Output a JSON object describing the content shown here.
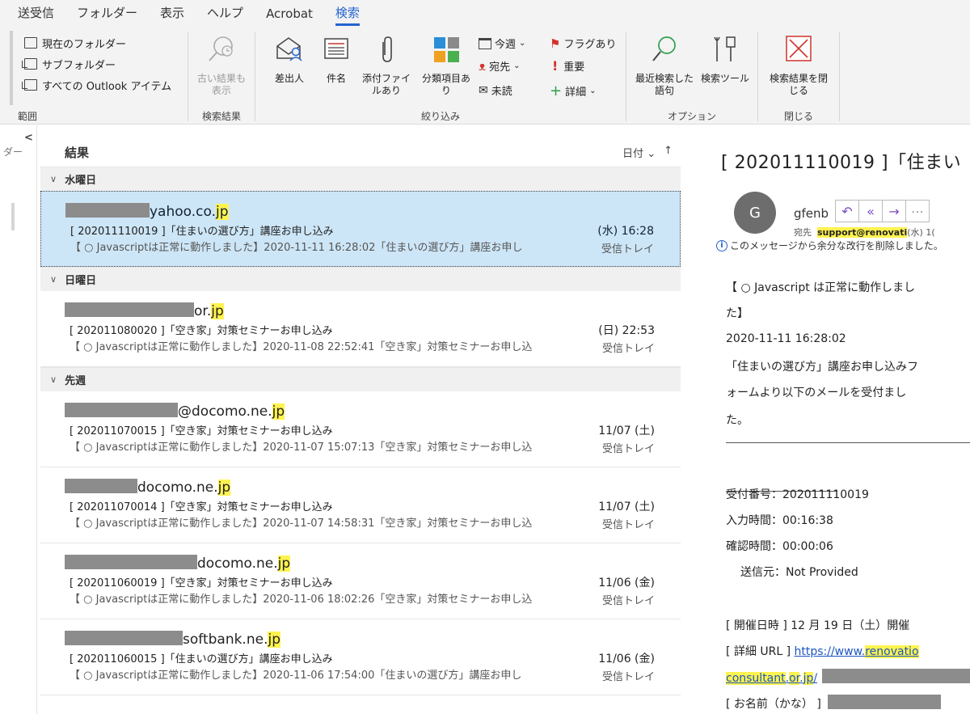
{
  "menu": {
    "tabs": [
      "送受信",
      "フォルダー",
      "表示",
      "ヘルプ",
      "Acrobat",
      "検索"
    ],
    "active": 5
  },
  "ribbon": {
    "scope": {
      "items": [
        "現在のフォルダー",
        "サブフォルダー",
        "すべての Outlook アイテム"
      ],
      "label": "範囲"
    },
    "results": {
      "button": "古い結果も表示",
      "label": "検索結果"
    },
    "refine": {
      "buttons": [
        "差出人",
        "件名",
        "添付ファイルあり",
        "分類項目あり"
      ],
      "small": {
        "this_week": "今週",
        "flag": "フラグあり",
        "to": "宛先",
        "important": "重要",
        "unread": "未読",
        "more": "詳細"
      },
      "label": "絞り込み"
    },
    "options": {
      "recent": "最近検索した語句",
      "tools": "検索ツール",
      "label": "オプション"
    },
    "close": {
      "button": "検索結果を閉じる",
      "label": "閉じる"
    }
  },
  "folder_pane": {
    "collapsed_label": "ダー"
  },
  "list": {
    "title": "結果",
    "sort_label": "日付",
    "groups": [
      {
        "name": "水曜日",
        "mails": [
          {
            "from_domain": "yahoo.co.",
            "from_hl": "jp",
            "subject": "[ 202011110019 ]「住まいの選び方」講座お申し込み",
            "preview": "【 ○ Javascriptは正常に動作しました】2020-11-11 16:28:02「住まいの選び方」講座お申し",
            "date": "(水) 16:28",
            "folder": "受信トレイ",
            "selected": true
          }
        ]
      },
      {
        "name": "日曜日",
        "mails": [
          {
            "from_domain": "or.",
            "from_hl": "jp",
            "subject": "[ 202011080020 ]「空き家」対策セミナーお申し込み",
            "preview": "【 ○ Javascriptは正常に動作しました】2020-11-08 22:52:41「空き家」対策セミナーお申し込",
            "date": "(日) 22:53",
            "folder": "受信トレイ"
          }
        ]
      },
      {
        "name": "先週",
        "mails": [
          {
            "from_domain": "@docomo.ne.",
            "from_hl": "jp",
            "subject": "[ 202011070015 ]「空き家」対策セミナーお申し込み",
            "preview": "【 ○ Javascriptは正常に動作しました】2020-11-07 15:07:13「空き家」対策セミナーお申し込",
            "date": "11/07 (土)",
            "folder": "受信トレイ"
          },
          {
            "from_domain": "docomo.ne.",
            "from_hl": "jp",
            "subject": "[ 202011070014 ]「空き家」対策セミナーお申し込み",
            "preview": "【 ○ Javascriptは正常に動作しました】2020-11-07 14:58:31「空き家」対策セミナーお申し込",
            "date": "11/07 (土)",
            "folder": "受信トレイ"
          },
          {
            "from_domain": "docomo.ne.",
            "from_hl": "jp",
            "subject": "[ 202011060019 ]「空き家」対策セミナーお申し込み",
            "preview": "【 ○ Javascriptは正常に動作しました】2020-11-06 18:02:26「空き家」対策セミナーお申し込",
            "date": "11/06 (金)",
            "folder": "受信トレイ"
          },
          {
            "from_domain": "softbank.ne.",
            "from_hl": "jp",
            "subject": "[ 202011060015 ]「住まいの選び方」講座お申し込み",
            "preview": "【 ○ Javascriptは正常に動作しました】2020-11-06 17:54:00「住まいの選び方」講座お申し",
            "date": "11/06 (金)",
            "folder": "受信トレイ"
          }
        ]
      }
    ]
  },
  "reading": {
    "subject": "[ 202011110019 ]「住まい",
    "avatar": "G",
    "sender": "gfenb",
    "to_label": "宛先",
    "to_address": "support@renovati",
    "to_suffix": "(水) 1(",
    "info": "このメッセージから余分な改行を削除しました。",
    "body": {
      "line1": "【 ○ Javascript は正常に動作しまし",
      "line2": "た】",
      "line3": "2020-11-11 16:28:02",
      "line4": "「住まいの選び方」講座お申し込みフ",
      "line5": "ォームより以下のメールを受付まし",
      "line6": "た。",
      "receipt": "受付番号：202011110019",
      "input_time": "入力時間：00:16:38",
      "confirm_time": "確認時間：00:00:06",
      "source": "送信元：Not Provided",
      "date_line": "[ 開催日時 ] 12 月 19 日（土）開催",
      "url_label": "[ 詳細 URL ] ",
      "url_a": "https://www.",
      "url_b": "renovatio",
      "url2_a": "consultant",
      "url2_b": ".",
      "url2_c": "or",
      "url2_d": ".",
      "url2_e": "jp",
      "url2_f": "/",
      "name_line": "[ お名前（かな） ]"
    }
  }
}
